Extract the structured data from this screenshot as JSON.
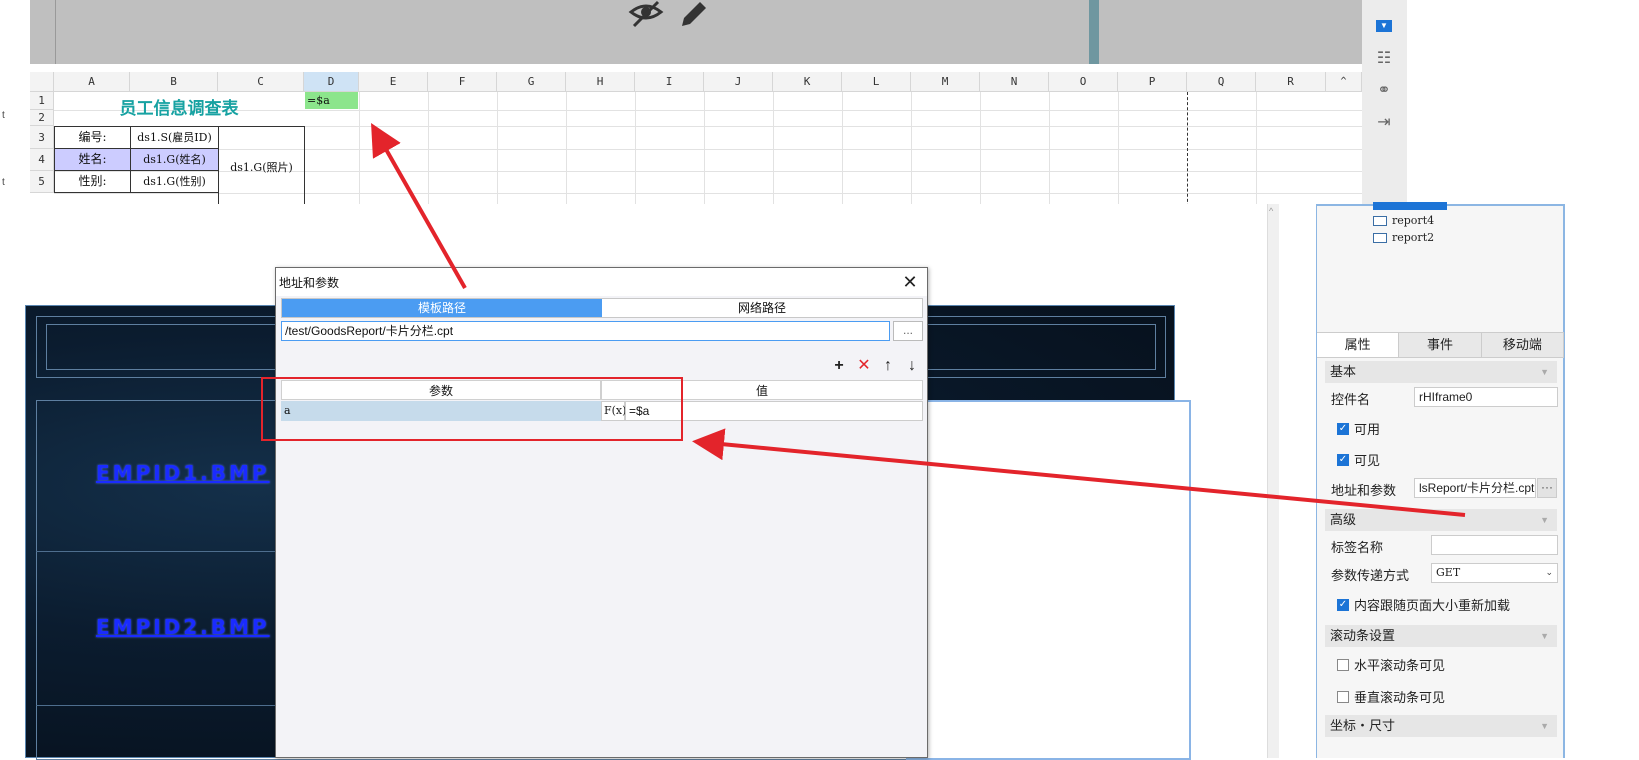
{
  "spreadsheet": {
    "columns": [
      "A",
      "B",
      "C",
      "D",
      "E",
      "F",
      "G",
      "H",
      "I",
      "J",
      "K",
      "L",
      "M",
      "N",
      "O",
      "P",
      "Q",
      "R"
    ],
    "rows": [
      "1",
      "2",
      "3",
      "4",
      "5"
    ],
    "row_side_marks": [
      "t",
      "t"
    ],
    "title_cell": "员工信息调查表",
    "d1_formula": "=$a",
    "cells": {
      "a3": "编号:",
      "b3": "ds1.S(雇员ID)",
      "a4": "姓名:",
      "b4": "ds1.G(姓名)",
      "a5": "性别:",
      "b5": "ds1.G(性别)",
      "c_photo": "ds1.G(照片)"
    }
  },
  "designer": {
    "emp_labels": [
      "EMPID1.BMP",
      "EMPID2.BMP"
    ]
  },
  "widget_tree": {
    "items": [
      "report4",
      "report2"
    ]
  },
  "property_panel": {
    "tabs": [
      "属性",
      "事件",
      "移动端"
    ],
    "basic": {
      "header": "基本",
      "name_label": "控件名",
      "name_value": "rHIframe0",
      "enabled_label": "可用",
      "visible_label": "可见",
      "address_label": "地址和参数",
      "address_value": "lsReport/卡片分栏.cpt",
      "address_btn": "···"
    },
    "advanced": {
      "header": "高级",
      "tag_label": "标签名称",
      "tag_value": "",
      "method_label": "参数传递方式",
      "method_value": "GET",
      "reload_label": "内容跟随页面大小重新加载"
    },
    "scrollbar": {
      "header": "滚动条设置",
      "h_label": "水平滚动条可见",
      "v_label": "垂直滚动条可见"
    },
    "coords_header": "坐标・尺寸"
  },
  "dialog": {
    "title": "地址和参数",
    "close": "✕",
    "tabs": [
      "模板路径",
      "网络路径"
    ],
    "path_value": "/test/GoodsReport/卡片分栏.cpt",
    "browse": "...",
    "toolbar": {
      "add": "+",
      "delete": "✕",
      "up": "↑",
      "down": "↓"
    },
    "columns": [
      "参数",
      "值"
    ],
    "params": [
      {
        "name": "a",
        "fx": "F(x)",
        "value": "=$a"
      }
    ]
  },
  "colors": {
    "accent_blue": "#4b9cf2",
    "annotation_red": "#e3242b",
    "title_teal": "#17a2a2",
    "formula_green": "#8ce58c",
    "lilac": "#ccccff"
  }
}
